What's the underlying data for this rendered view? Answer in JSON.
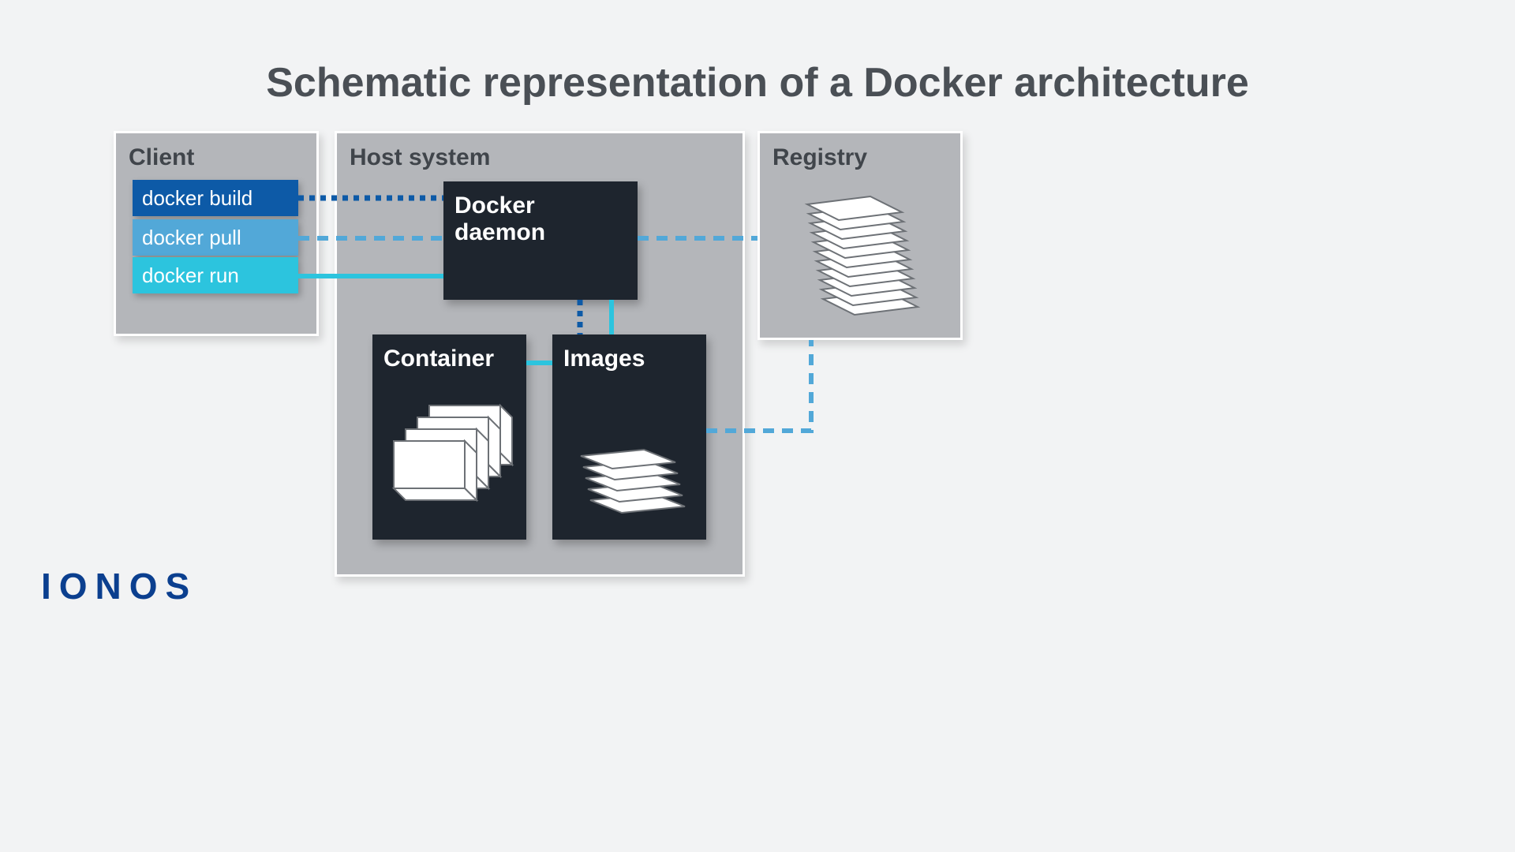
{
  "title": "Schematic representation of a Docker architecture",
  "panels": {
    "client": "Client",
    "host": "Host system",
    "registry": "Registry"
  },
  "commands": {
    "build": "docker build",
    "pull": "docker pull",
    "run": "docker run"
  },
  "boxes": {
    "daemon": "Docker daemon",
    "container": "Container",
    "images": "Images"
  },
  "logo": "IONOS",
  "colors": {
    "build": "#0d5aa7",
    "pull": "#52a8d8",
    "run": "#2cc4de",
    "dark": "#1e252e",
    "panel": "#b4b6ba"
  }
}
